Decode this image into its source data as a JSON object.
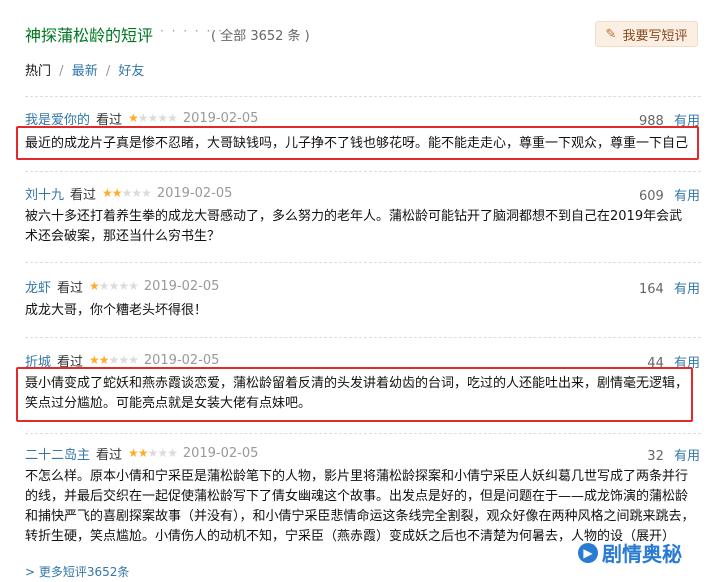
{
  "header": {
    "title": "神探蒲松龄的短评",
    "dots": "· · · · · ·",
    "count": "( 全部 3652 条 )",
    "write_label": "我要写短评"
  },
  "tabs": {
    "hot": "热门",
    "sep": "/",
    "latest": "最新",
    "friends": "好友"
  },
  "reviews": [
    {
      "user": "我是爱你的",
      "seen": "看过",
      "rating": 1,
      "date": "2019-02-05",
      "votes": "988",
      "useful": "有用",
      "text": "最近的成龙片子真是惨不忍睹，大哥缺钱吗，儿子挣不了钱也够花呀。能不能走走心，尊重一下观众，尊重一下自己"
    },
    {
      "user": "刘十九",
      "seen": "看过",
      "rating": 2,
      "date": "2019-02-05",
      "votes": "609",
      "useful": "有用",
      "text": "被六十多还打着养生拳的成龙大哥感动了，多么努力的老年人。蒲松龄可能钻开了脑洞都想不到自己在2019年会武术还会破案，那还当什么穷书生？"
    },
    {
      "user": "龙虾",
      "seen": "看过",
      "rating": 1,
      "date": "2019-02-05",
      "votes": "164",
      "useful": "有用",
      "text": "成龙大哥，你个糟老头坏得很！"
    },
    {
      "user": "折城",
      "seen": "看过",
      "rating": 2,
      "date": "2019-02-05",
      "votes": "44",
      "useful": "有用",
      "text": "聂小倩变成了蛇妖和燕赤霞谈恋爱，蒲松龄留着反清的头发讲着幼齿的台词，吃过的人还能吐出来，剧情毫无逻辑，笑点过分尴尬。可能亮点就是女装大佬有点妹吧。"
    },
    {
      "user": "二十二岛主",
      "seen": "看过",
      "rating": 2,
      "date": "2019-02-05",
      "votes": "32",
      "useful": "有用",
      "text": "不怎么样。原本小倩和宁采臣是蒲松龄笔下的人物，影片里将蒲松龄探案和小倩宁采臣人妖纠葛几世写成了两条并行的线，并最后交织在一起促使蒲松龄写下了倩女幽魂这个故事。出发点是好的，但是问题在于——成龙饰演的蒲松龄和捕快严飞的喜剧探案故事（并没有），和小倩宁采臣悲情命运这条线完全割裂，观众好像在两种风格之间跳来跳去，转折生硬，笑点尴尬。小倩伤人的动机不知，宁采臣（燕赤霞）变成妖之后也不清楚为何暑去，人物的设（展开）"
    }
  ],
  "more_link": "> 更多短评3652条",
  "watermark": "剧情奥秘",
  "colors": {
    "highlight_box": "#e22a2a",
    "link": "#3377aa",
    "title": "#007722",
    "star": "#ffac2d"
  }
}
